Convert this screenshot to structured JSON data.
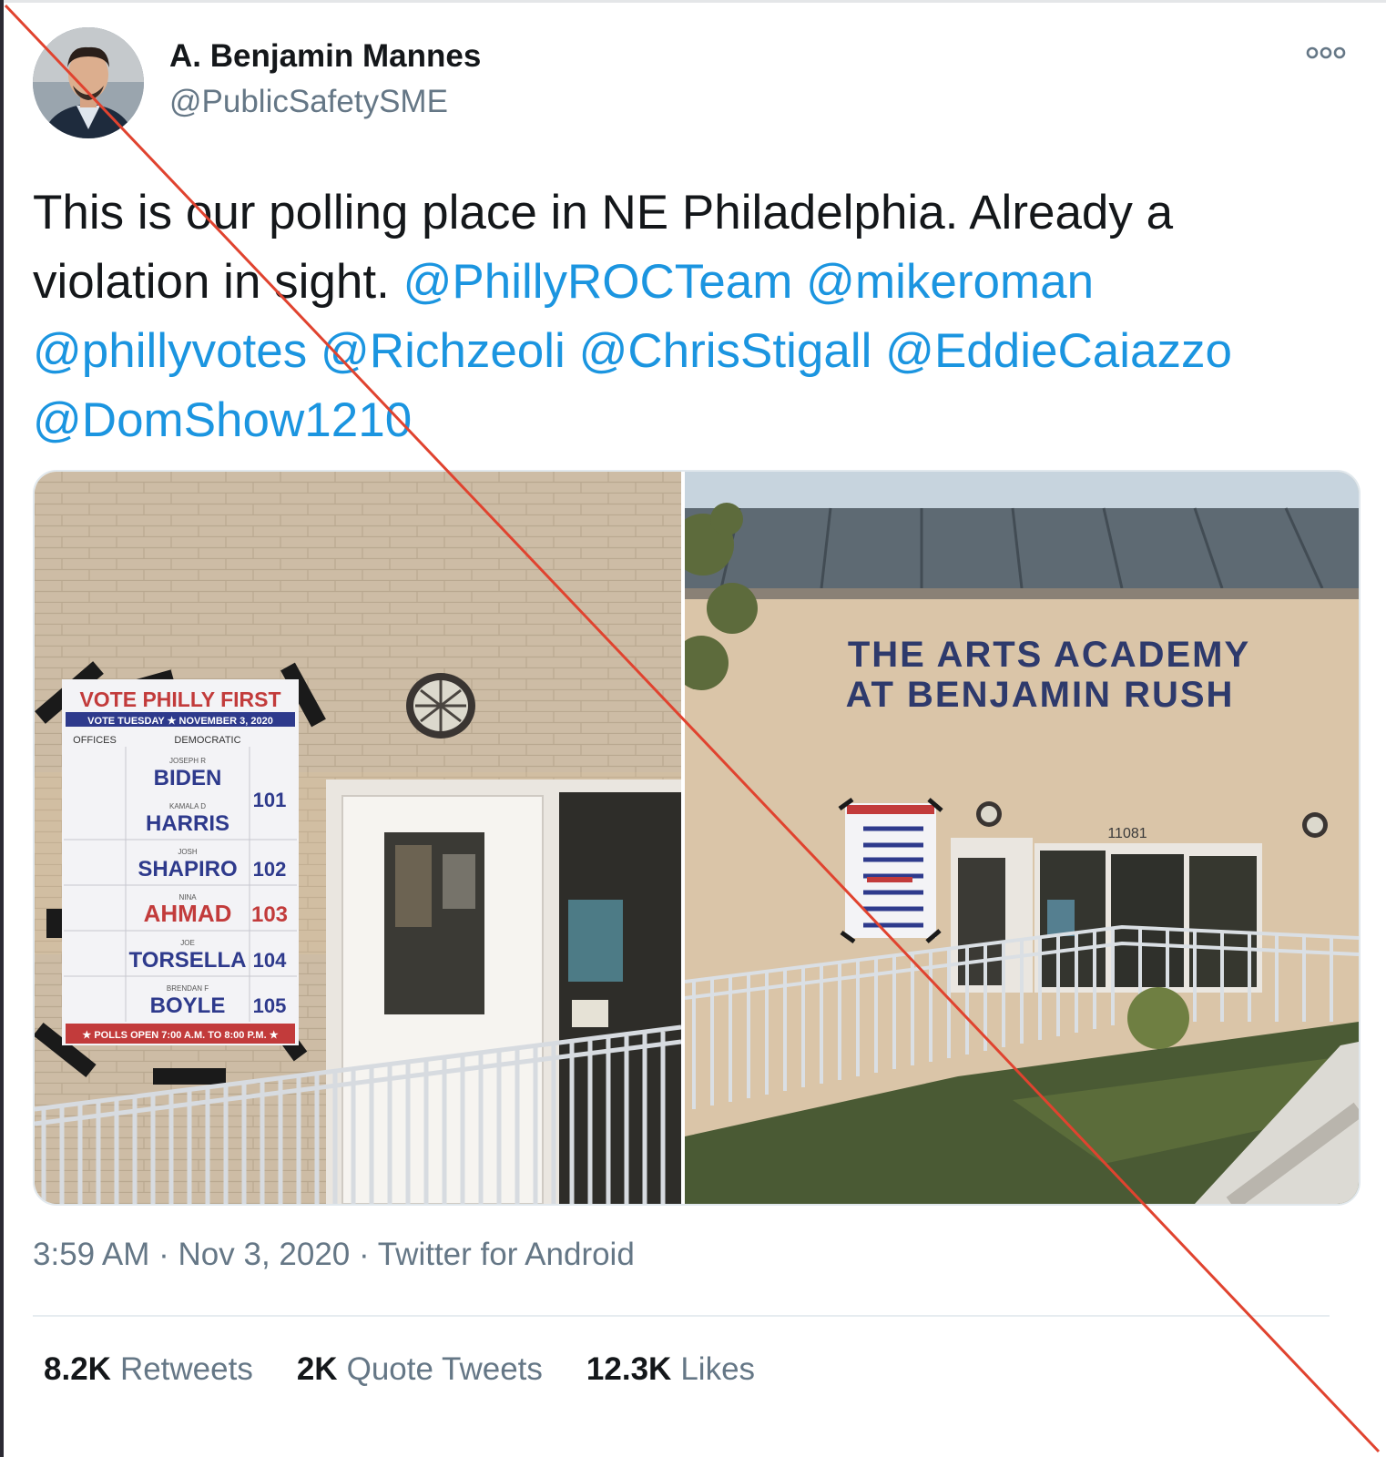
{
  "tweet": {
    "author": {
      "display_name": "A. Benjamin Mannes",
      "handle": "@PublicSafetySME"
    },
    "more_menu_icon": "more-horizontal-icon",
    "text_lines": [
      "This is our polling place in NE Philadelphia. Already a",
      "violation in sight. "
    ],
    "mentions": [
      "@PhillyROCTeam",
      "@mikeroman",
      "@phillyvotes",
      "@Richzeoli",
      "@ChrisStigall",
      "@EddieCaiazzo",
      "@DomShow1210"
    ],
    "photos": {
      "left": {
        "sign": {
          "title": "VOTE PHILLY FIRST",
          "subtitle": "VOTE TUESDAY ★ NOVEMBER 3, 2020",
          "col_offices": "OFFICES",
          "col_party": "DEMOCRATIC",
          "candidates": [
            {
              "first": "JOSEPH R",
              "last": "BIDEN",
              "number": "101"
            },
            {
              "first": "KAMALA D",
              "last": "HARRIS",
              "number": ""
            },
            {
              "first": "JOSH",
              "last": "SHAPIRO",
              "number": "102"
            },
            {
              "first": "NINA",
              "last": "AHMAD",
              "number": "103"
            },
            {
              "first": "JOE",
              "last": "TORSELLA",
              "number": "104"
            },
            {
              "first": "BRENDAN F",
              "last": "BOYLE",
              "number": "105"
            }
          ],
          "footer": "★ POLLS OPEN 7:00 A.M. TO 8:00 P.M. ★"
        }
      },
      "right": {
        "building_line1": "THE ARTS ACADEMY",
        "building_line2": "AT BENJAMIN RUSH",
        "address_number": "11081"
      }
    },
    "timestamp": "3:59 AM · Nov 3, 2020 · ",
    "source": "Twitter for Android",
    "stats": [
      {
        "count": "8.2K",
        "label": "Retweets"
      },
      {
        "count": "2K",
        "label": "Quote Tweets"
      },
      {
        "count": "12.3K",
        "label": "Likes"
      }
    ]
  },
  "colors": {
    "link": "#1b95e0",
    "secondary_text": "#657786",
    "strike_line": "#e0432f"
  }
}
